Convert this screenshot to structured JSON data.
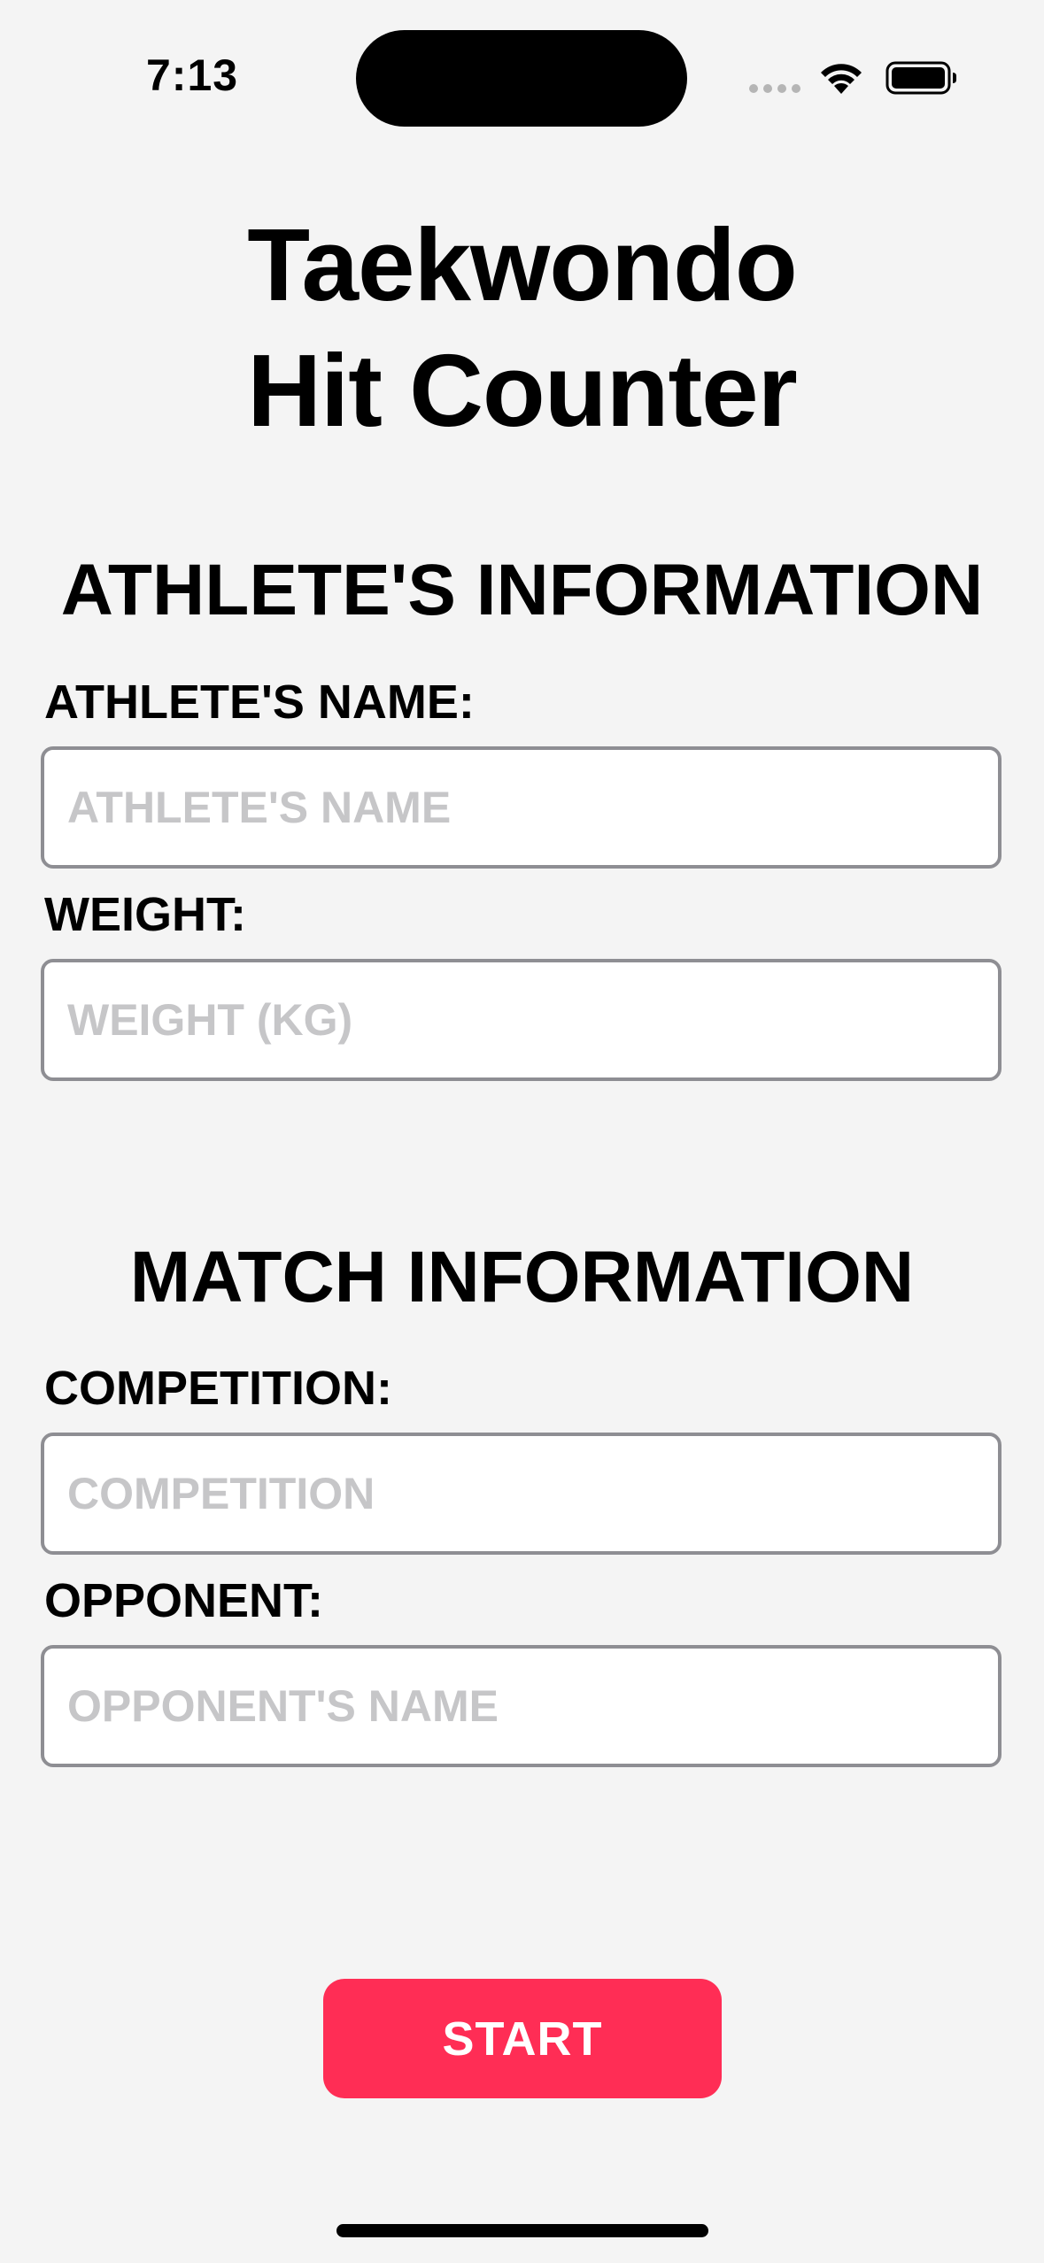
{
  "status_bar": {
    "time": "7:13",
    "icons": [
      "signal-dots-icon",
      "wifi-icon",
      "battery-icon"
    ]
  },
  "title": {
    "line1": "Taekwondo",
    "line2": "Hit Counter"
  },
  "athlete_section": {
    "heading": "ATHLETE'S INFORMATION",
    "name_label": "ATHLETE'S NAME:",
    "name_placeholder": "ATHLETE'S NAME",
    "name_value": "",
    "weight_label": "WEIGHT:",
    "weight_placeholder": "WEIGHT (KG)",
    "weight_value": ""
  },
  "match_section": {
    "heading": "MATCH INFORMATION",
    "competition_label": "COMPETITION:",
    "competition_placeholder": "COMPETITION",
    "competition_value": "",
    "opponent_label": "OPPONENT:",
    "opponent_placeholder": "OPPONENT'S NAME",
    "opponent_value": ""
  },
  "actions": {
    "start_label": "START"
  },
  "colors": {
    "background": "#f4f4f4",
    "accent": "#ff2d55",
    "input_border": "#8e8e93",
    "placeholder": "#c6c6c8"
  }
}
